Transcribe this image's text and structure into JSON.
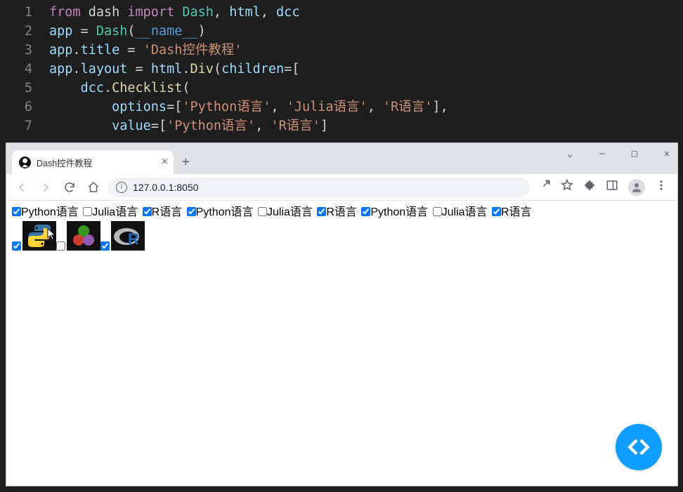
{
  "editor": {
    "lines": [
      {
        "n": "1",
        "tokens": [
          [
            "kw",
            "from"
          ],
          [
            "",
            " dash "
          ],
          [
            "kw",
            "import"
          ],
          [
            "",
            " "
          ],
          [
            "mod",
            "Dash"
          ],
          [
            "punc",
            ", "
          ],
          [
            "var",
            "html"
          ],
          [
            "punc",
            ", "
          ],
          [
            "var",
            "dcc"
          ]
        ]
      },
      {
        "n": "2",
        "tokens": [
          [
            "var",
            "app"
          ],
          [
            "op",
            " = "
          ],
          [
            "mod",
            "Dash"
          ],
          [
            "punc",
            "("
          ],
          [
            "name",
            "__name__"
          ],
          [
            "punc",
            ")"
          ]
        ]
      },
      {
        "n": "3",
        "tokens": [
          [
            "var",
            "app"
          ],
          [
            "punc",
            "."
          ],
          [
            "var",
            "title"
          ],
          [
            "op",
            " = "
          ],
          [
            "str",
            "'Dash控件教程'"
          ]
        ]
      },
      {
        "n": "4",
        "tokens": [
          [
            "var",
            "app"
          ],
          [
            "punc",
            "."
          ],
          [
            "var",
            "layout"
          ],
          [
            "op",
            " = "
          ],
          [
            "var",
            "html"
          ],
          [
            "punc",
            "."
          ],
          [
            "fn",
            "Div"
          ],
          [
            "punc",
            "("
          ],
          [
            "var",
            "children"
          ],
          [
            "op",
            "="
          ],
          [
            "punc",
            "["
          ]
        ]
      },
      {
        "n": "5",
        "tokens": [
          [
            "",
            "    "
          ],
          [
            "var",
            "dcc"
          ],
          [
            "punc",
            "."
          ],
          [
            "fn",
            "Checklist"
          ],
          [
            "punc",
            "("
          ]
        ]
      },
      {
        "n": "6",
        "tokens": [
          [
            "",
            "        "
          ],
          [
            "var",
            "options"
          ],
          [
            "op",
            "="
          ],
          [
            "punc",
            "["
          ],
          [
            "str",
            "'Python语言'"
          ],
          [
            "punc",
            ", "
          ],
          [
            "str",
            "'Julia语言'"
          ],
          [
            "punc",
            ", "
          ],
          [
            "str",
            "'R语言'"
          ],
          [
            "punc",
            "],"
          ]
        ]
      },
      {
        "n": "7",
        "tokens": [
          [
            "",
            "        "
          ],
          [
            "var",
            "value"
          ],
          [
            "op",
            "="
          ],
          [
            "punc",
            "["
          ],
          [
            "str",
            "'Python语言'"
          ],
          [
            "punc",
            ", "
          ],
          [
            "str",
            "'R语言'"
          ],
          [
            "punc",
            "]"
          ]
        ]
      }
    ]
  },
  "browser": {
    "tab_title": "Dash控件教程",
    "url": "127.0.0.1:8050"
  },
  "page": {
    "checklists": [
      [
        {
          "label": "Python语言",
          "checked": true
        },
        {
          "label": "Julia语言",
          "checked": false
        },
        {
          "label": "R语言",
          "checked": true
        }
      ],
      [
        {
          "label": "Python语言",
          "checked": true
        },
        {
          "label": "Julia语言",
          "checked": false
        },
        {
          "label": "R语言",
          "checked": true
        }
      ],
      [
        {
          "label": "Python语言",
          "checked": true
        },
        {
          "label": "Julia语言",
          "checked": false
        },
        {
          "label": "R语言",
          "checked": true
        }
      ]
    ],
    "image_checklist": [
      {
        "name": "python",
        "checked": true
      },
      {
        "name": "julia",
        "checked": false
      },
      {
        "name": "r",
        "checked": true
      }
    ]
  }
}
